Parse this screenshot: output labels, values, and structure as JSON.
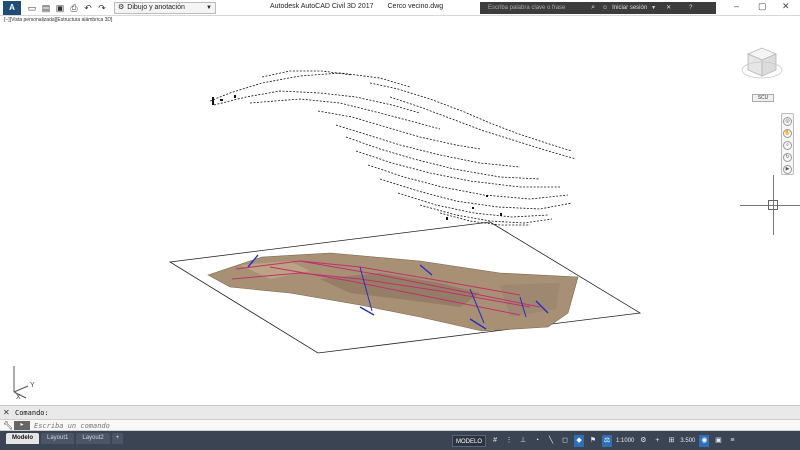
{
  "titlebar": {
    "app_logo": "A",
    "workspace": "Dibujo y anotación",
    "app_name": "Autodesk AutoCAD Civil 3D 2017",
    "file_name": "Cerco vecino.dwg",
    "search_placeholder": "Escriba palabra clave o frase",
    "signin": "Iniciar sesión",
    "qat_icons": [
      "new-icon",
      "open-icon",
      "save-icon",
      "print-icon",
      "undo-icon",
      "redo-icon"
    ]
  },
  "viewport": {
    "label": "[−][Vista personalizada][Estructura alámbrica 3D]",
    "wcs_label": "SCU"
  },
  "ucs": {
    "x_label": "X",
    "y_label": "Y"
  },
  "command": {
    "history_label": "Comando:",
    "placeholder": "Escriba un comando",
    "close_symbol": "✕",
    "prompt_symbol": "▸"
  },
  "statusbar": {
    "tabs": [
      {
        "label": "Modelo",
        "active": true
      },
      {
        "label": "Layout1",
        "active": false
      },
      {
        "label": "Layout2",
        "active": false
      }
    ],
    "add_tab": "+",
    "model_label": "MODELO",
    "scale": "1:1000",
    "precision": "3.500"
  },
  "colors": {
    "statusbar_bg": "#3b4453",
    "alignment_magenta": "#c0306e",
    "alignment_blue": "#2230c8",
    "terrain": "#a89074"
  }
}
